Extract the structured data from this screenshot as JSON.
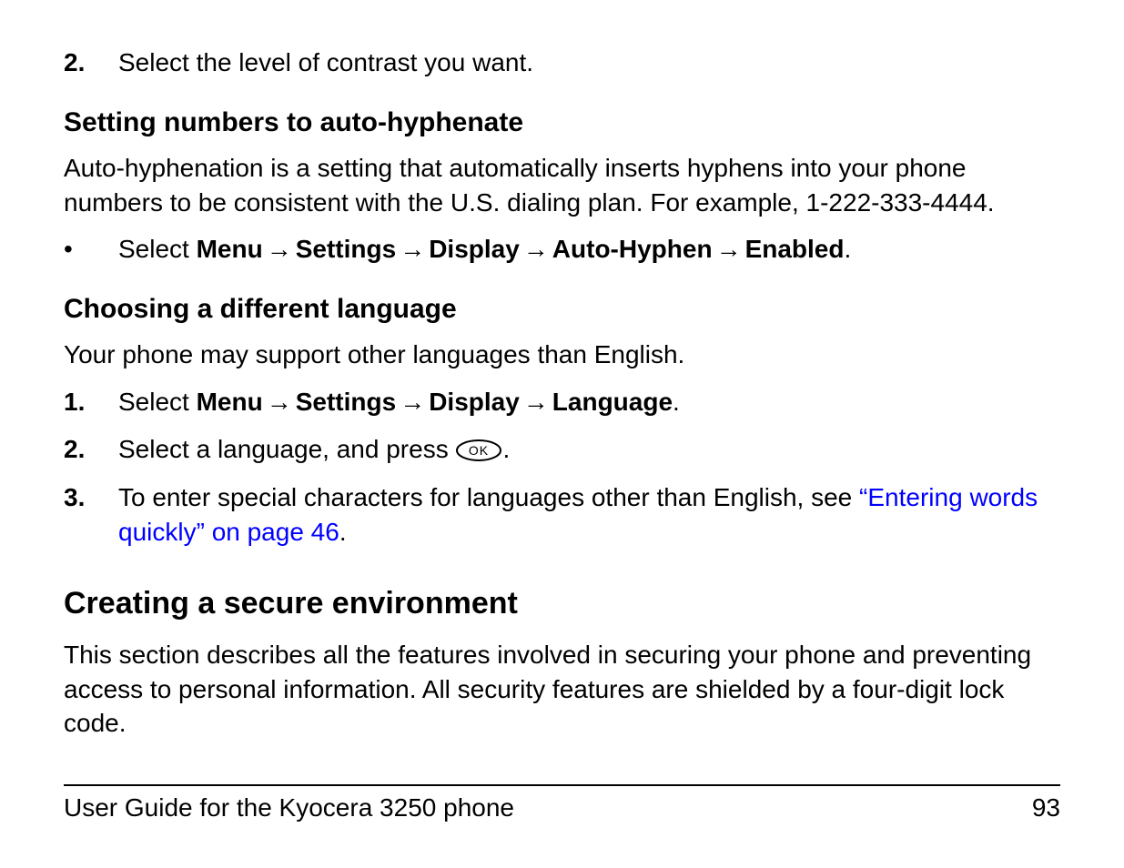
{
  "step2_top": {
    "marker": "2.",
    "text": "Select the level of contrast you want."
  },
  "heading_autohyphen": "Setting numbers to auto-hyphenate",
  "para_autohyphen": "Auto-hyphenation is a setting that automatically inserts hyphens into your phone numbers to be consistent with the U.S. dialing plan. For example, 1-222-333-4444.",
  "bullet_autohyphen": {
    "lead": "Select ",
    "path": [
      "Menu",
      "Settings",
      "Display",
      "Auto-Hyphen",
      "Enabled"
    ]
  },
  "heading_language": "Choosing a different language",
  "para_language": "Your phone may support other languages than English.",
  "lang_step1": {
    "marker": "1.",
    "lead": "Select ",
    "path": [
      "Menu",
      "Settings",
      "Display",
      "Language"
    ]
  },
  "lang_step2": {
    "marker": "2.",
    "before": "Select a language, and press ",
    "after": "."
  },
  "lang_step3": {
    "marker": "3.",
    "before": "To enter special characters for languages other than English, see ",
    "link": "“Entering words quickly” on page 46",
    "after": "."
  },
  "heading_secure": "Creating a secure environment",
  "para_secure": "This section describes all the features involved in securing your phone and preventing access to personal information. All security features are shielded by a four-digit lock code.",
  "footer": {
    "title": "User Guide for the Kyocera 3250 phone",
    "page": "93"
  },
  "arrow_glyph": "→",
  "bullet_glyph": "•"
}
